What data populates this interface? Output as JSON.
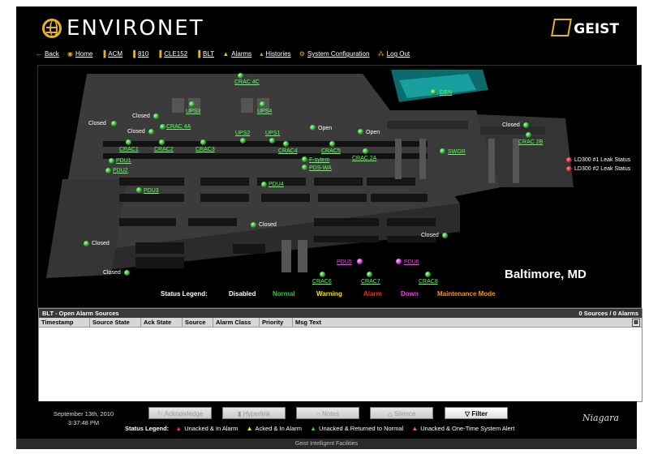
{
  "app": {
    "title": "ENVIRONET",
    "brand": "GEIST"
  },
  "nav": [
    {
      "label": "Back",
      "icon": "back-arrow-icon"
    },
    {
      "label": "Home",
      "icon": "home-icon"
    },
    {
      "label": "ACM",
      "icon": "bar-chart-icon"
    },
    {
      "label": "810",
      "icon": "bar-chart-icon"
    },
    {
      "label": "CLE152",
      "icon": "bar-chart-icon"
    },
    {
      "label": "BLT",
      "icon": "bar-chart-icon"
    },
    {
      "label": "Alarms",
      "icon": "bell-icon"
    },
    {
      "label": "Histories",
      "icon": "histories-icon"
    },
    {
      "label": "System Configuration",
      "icon": "gear-icon"
    },
    {
      "label": "Log Out",
      "icon": "key-icon"
    }
  ],
  "map": {
    "location": "Baltimore, MD",
    "labels": {
      "crac4c": "CRAC 4C",
      "ups3": "UPS3",
      "ups4": "UPS4",
      "gen": "GEN",
      "crac4a": "CRAC 4A",
      "ups2": "UPS2",
      "ups1": "UPS1",
      "crac2b": "CRAC 2B",
      "crac1": "CRAC1",
      "crac2": "CRAC2",
      "crac3": "CRAC3",
      "crac4": "CRAC4",
      "crac5": "CRAC5",
      "crac2a": "CRAC 2A",
      "swgr": "SWGR",
      "pdu1": "PDU1",
      "pdu2": "PDU2",
      "fsystem": "F-sytem",
      "pdswa": "PDS-WA",
      "pdu3": "PDU3",
      "pdu4": "PDU4",
      "pdu5": "PDU5",
      "pdu6": "PDU6",
      "crac6": "CRAC6",
      "crac7": "CRAC7",
      "crac8": "CRAC8"
    },
    "status_text": {
      "closed_a": "Closed",
      "closed_b": "Closed",
      "closed_c": "Closed",
      "open_a": "Open",
      "open_b": "Open",
      "closed_d": "Closed",
      "closed_e": "Closed",
      "closed_f": "Closed",
      "closed_g": "Closed",
      "closed_h": "Closed"
    },
    "leak": [
      "LD300 #1 Leak Status",
      "LD300 #2 Leak Status"
    ],
    "status_legend": {
      "title": "Status Legend:",
      "items": [
        {
          "label": "Disabled",
          "color": "#ffffff"
        },
        {
          "label": "Normal",
          "color": "#33cc33"
        },
        {
          "label": "Warning",
          "color": "#ffe600"
        },
        {
          "label": "Alarm",
          "color": "#ff2a2a"
        },
        {
          "label": "Down",
          "color": "#ff33ff"
        },
        {
          "label": "Maintenance Mode",
          "color": "#ff9900"
        }
      ]
    }
  },
  "alarm_panel": {
    "title": "BLT - Open Alarm Sources",
    "count": "0 Sources / 0 Alarms",
    "columns": [
      "Timestamp",
      "Source State",
      "Ack State",
      "Source",
      "Alarm Class",
      "Priority",
      "Msg Text"
    ]
  },
  "footer": {
    "date": "September 13th, 2010",
    "time": "3:37:48 PM",
    "buttons": [
      {
        "label": "Acknowledge",
        "icon": "acknowledge-icon"
      },
      {
        "label": "Hyperlink",
        "icon": "hyperlink-icon"
      },
      {
        "label": "Notes",
        "icon": "notes-icon"
      },
      {
        "label": "Silence",
        "icon": "silence-icon"
      },
      {
        "label": "Filter",
        "icon": "filter-icon"
      }
    ],
    "legend_title": "Status Legend:",
    "legend": [
      {
        "label": "Unacked & In Alarm",
        "color": "#ff2a2a"
      },
      {
        "label": "Acked & In Alarm",
        "color": "#ffe600"
      },
      {
        "label": "Unacked & Returned to Normal",
        "color": "#33cc33"
      },
      {
        "label": "Unacked & One-Time System Alert",
        "color": "#ff6a1a"
      }
    ],
    "brand": "Niagara",
    "bottom": "Geist Intelligent Facilities"
  }
}
